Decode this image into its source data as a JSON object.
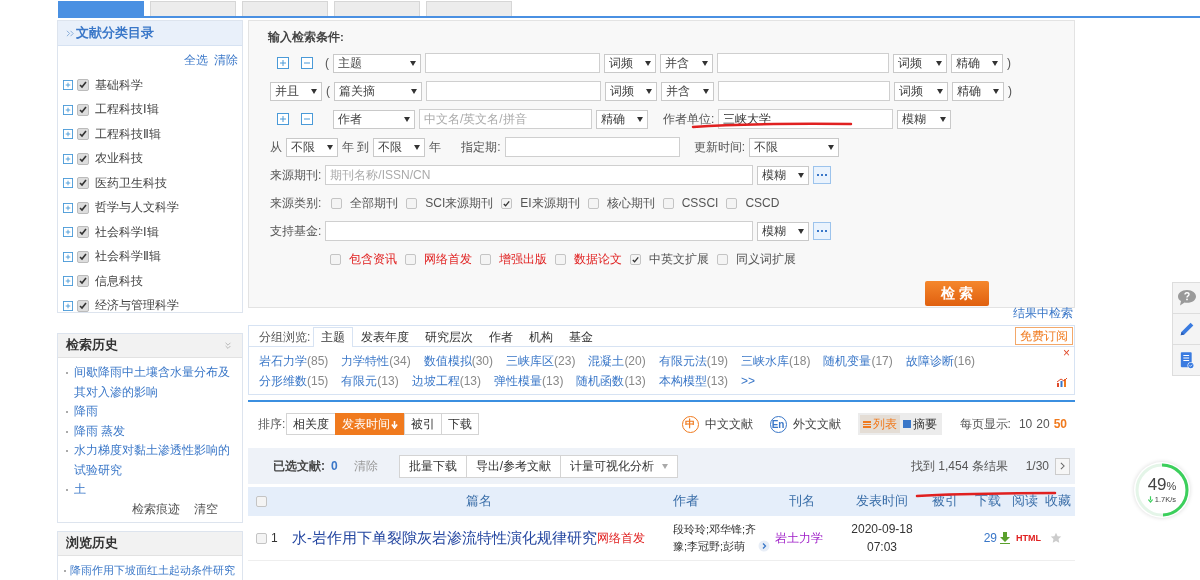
{
  "top_tabs": [
    {
      "selected": true
    },
    {
      "selected": false
    },
    {
      "selected": false
    },
    {
      "selected": false
    },
    {
      "selected": false
    }
  ],
  "category_panel": {
    "title": "文献分类目录",
    "select_all": "全选",
    "clear": "清除",
    "items": [
      {
        "label": "基础科学",
        "checked": true
      },
      {
        "label": "工程科技Ⅰ辑",
        "checked": true
      },
      {
        "label": "工程科技Ⅱ辑",
        "checked": true
      },
      {
        "label": "农业科技",
        "checked": true
      },
      {
        "label": "医药卫生科技",
        "checked": true
      },
      {
        "label": "哲学与人文科学",
        "checked": true
      },
      {
        "label": "社会科学Ⅰ辑",
        "checked": true
      },
      {
        "label": "社会科学Ⅱ辑",
        "checked": true
      },
      {
        "label": "信息科技",
        "checked": true
      },
      {
        "label": "经济与管理科学",
        "checked": true
      }
    ]
  },
  "search_history": {
    "title": "检索历史",
    "items": [
      "间歇降雨中土壤含水量分布及其对入渗的影响",
      "降雨",
      "降雨 蒸发",
      "水力梯度对黏土渗透性影响的试验研究",
      "土"
    ],
    "trace": "检索痕迹",
    "clear": "清空"
  },
  "browse_history": {
    "title": "浏览历史",
    "items": [
      "降雨作用下坡面红土起动条件研究"
    ]
  },
  "search_form": {
    "title": "输入检索条件:",
    "rows": [
      {
        "parts": [
          {
            "kind": "plus"
          },
          {
            "kind": "minus"
          },
          {
            "kind": "paren",
            "text": "("
          },
          {
            "kind": "select",
            "value": "主题"
          },
          {
            "kind": "input"
          },
          {
            "kind": "select",
            "value": "词频"
          },
          {
            "kind": "select",
            "value": "并含"
          },
          {
            "kind": "input"
          },
          {
            "kind": "select",
            "value": "词频"
          },
          {
            "kind": "select",
            "value": "精确"
          },
          {
            "kind": "paren",
            "text": ")"
          }
        ]
      },
      {
        "parts": [
          {
            "kind": "select",
            "value": "并且"
          },
          {
            "kind": "paren",
            "text": "("
          },
          {
            "kind": "select",
            "value": "篇关摘"
          },
          {
            "kind": "input"
          },
          {
            "kind": "select",
            "value": "词频"
          },
          {
            "kind": "select",
            "value": "并含"
          },
          {
            "kind": "input"
          },
          {
            "kind": "select",
            "value": "词频"
          },
          {
            "kind": "select",
            "value": "精确"
          },
          {
            "kind": "paren",
            "text": ")"
          }
        ]
      },
      {
        "parts": [
          {
            "kind": "plus"
          },
          {
            "kind": "minus"
          },
          {
            "kind": "select",
            "value": "作者"
          },
          {
            "kind": "input",
            "placeholder": "中文名/英文名/拼音"
          },
          {
            "kind": "select",
            "value": "精确"
          },
          {
            "kind": "label",
            "text": "作者单位:"
          },
          {
            "kind": "input",
            "value": "三峡大学"
          },
          {
            "kind": "select",
            "value": "模糊"
          }
        ]
      },
      {
        "parts": [
          {
            "kind": "label",
            "text": "从"
          },
          {
            "kind": "select",
            "value": "不限"
          },
          {
            "kind": "label",
            "text": "年 到"
          },
          {
            "kind": "select",
            "value": "不限"
          },
          {
            "kind": "label",
            "text": "年"
          },
          {
            "kind": "label",
            "text": "指定期:"
          },
          {
            "kind": "input"
          },
          {
            "kind": "label",
            "text": "更新时间:"
          },
          {
            "kind": "select",
            "value": "不限"
          }
        ]
      },
      {
        "parts": [
          {
            "kind": "label",
            "text": "来源期刊:"
          },
          {
            "kind": "input",
            "placeholder": "期刊名称/ISSN/CN"
          },
          {
            "kind": "select",
            "value": "模糊"
          },
          {
            "kind": "more"
          }
        ]
      },
      {
        "parts": [
          {
            "kind": "label",
            "text": "来源类别:"
          },
          {
            "kind": "checkbox",
            "label": "全部期刊",
            "checked": false
          },
          {
            "kind": "checkbox",
            "label": "SCI来源期刊",
            "checked": false
          },
          {
            "kind": "checkbox",
            "label": "EI来源期刊",
            "checked": true
          },
          {
            "kind": "checkbox",
            "label": "核心期刊",
            "checked": false
          },
          {
            "kind": "checkbox",
            "label": "CSSCI",
            "checked": false
          },
          {
            "kind": "checkbox",
            "label": "CSCD",
            "checked": false
          }
        ]
      },
      {
        "parts": [
          {
            "kind": "label",
            "text": "支持基金:"
          },
          {
            "kind": "input"
          },
          {
            "kind": "select",
            "value": "模糊"
          },
          {
            "kind": "more"
          }
        ]
      },
      {
        "parts": [
          {
            "kind": "checkbox",
            "label": "包含资讯",
            "checked": false,
            "highlight": true
          },
          {
            "kind": "checkbox",
            "label": "网络首发",
            "checked": false,
            "highlight": true
          },
          {
            "kind": "checkbox",
            "label": "增强出版",
            "checked": false,
            "highlight": true
          },
          {
            "kind": "checkbox",
            "label": "数据论文",
            "checked": false,
            "highlight": true
          },
          {
            "kind": "checkbox",
            "label": "中英文扩展",
            "checked": true,
            "highlight": false
          },
          {
            "kind": "checkbox",
            "label": "同义词扩展",
            "checked": false,
            "highlight": false
          }
        ]
      }
    ],
    "search_button": "检 索",
    "within_results": "结果中检索"
  },
  "group_browse": {
    "label": "分组浏览:",
    "tabs": [
      {
        "label": "主题",
        "selected": true
      },
      {
        "label": "发表年度",
        "selected": false
      },
      {
        "label": "研究层次",
        "selected": false
      },
      {
        "label": "作者",
        "selected": false
      },
      {
        "label": "机构",
        "selected": false
      },
      {
        "label": "基金",
        "selected": false
      }
    ],
    "subscribe": "免费订阅",
    "close": "×",
    "terms": [
      [
        {
          "name": "岩石力学",
          "count": "(85)"
        },
        {
          "name": "力学特性",
          "count": "(34)"
        },
        {
          "name": "数值模拟",
          "count": "(30)"
        },
        {
          "name": "三峡库区",
          "count": "(23)"
        },
        {
          "name": "混凝土",
          "count": "(20)"
        },
        {
          "name": "有限元法",
          "count": "(19)"
        },
        {
          "name": "三峡水库",
          "count": "(18)"
        },
        {
          "name": "随机变量",
          "count": "(17)"
        },
        {
          "name": "故障诊断",
          "count": "(16)"
        }
      ],
      [
        {
          "name": "分形维数",
          "count": "(15)"
        },
        {
          "name": "有限元",
          "count": "(13)"
        },
        {
          "name": "边坡工程",
          "count": "(13)"
        },
        {
          "name": "弹性模量",
          "count": "(13)"
        },
        {
          "name": "随机函数",
          "count": "(13)"
        },
        {
          "name": "本构模型",
          "count": "(13)"
        }
      ]
    ],
    "more": ">>"
  },
  "results": {
    "sort_label": "排序:",
    "sort_options": [
      {
        "label": "相关度",
        "selected": false
      },
      {
        "label": "发表时间",
        "selected": true
      },
      {
        "label": "被引",
        "selected": false
      },
      {
        "label": "下载",
        "selected": false
      }
    ],
    "language_filters": [
      {
        "icon": "中",
        "label": "中文文献",
        "color": "#f07a1e"
      },
      {
        "icon": "En",
        "label": "外文文献",
        "color": "#3a77c8"
      }
    ],
    "views": [
      {
        "label": "列表",
        "selected": true
      },
      {
        "label": "摘要",
        "selected": false
      }
    ],
    "page_size_label": "每页显示:",
    "page_sizes": [
      {
        "label": "10",
        "selected": false
      },
      {
        "label": "20",
        "selected": false
      },
      {
        "label": "50",
        "selected": true
      }
    ],
    "selected_label": "已选文献:",
    "selected_count": "0",
    "clear": "清除",
    "actions": [
      {
        "label": "批量下载",
        "dropdown": false
      },
      {
        "label": "导出/参考文献",
        "dropdown": false
      },
      {
        "label": "计量可视化分析",
        "dropdown": true
      }
    ],
    "found": "找到 1,454 条结果",
    "page": "1/30",
    "select_all_checked": false,
    "columns": [
      "篇名",
      "作者",
      "刊名",
      "发表时间",
      "被引",
      "下载",
      "阅读",
      "收藏"
    ],
    "rows": [
      {
        "index": "1",
        "checked": false,
        "title": "水-岩作用下单裂隙灰岩渗流特性演化规律研究",
        "badge": "网络首发",
        "authors": "段玲玲;邓华锋;齐豫;李冠野;彭萌",
        "journal": "岩土力学",
        "date": "2020-09-18",
        "time": "07:03",
        "downloads": "29",
        "read": "HTML"
      }
    ]
  },
  "speed_meter": {
    "percent": "49",
    "unit": "%",
    "rate": "1.7K/s",
    "level": 0.49
  }
}
